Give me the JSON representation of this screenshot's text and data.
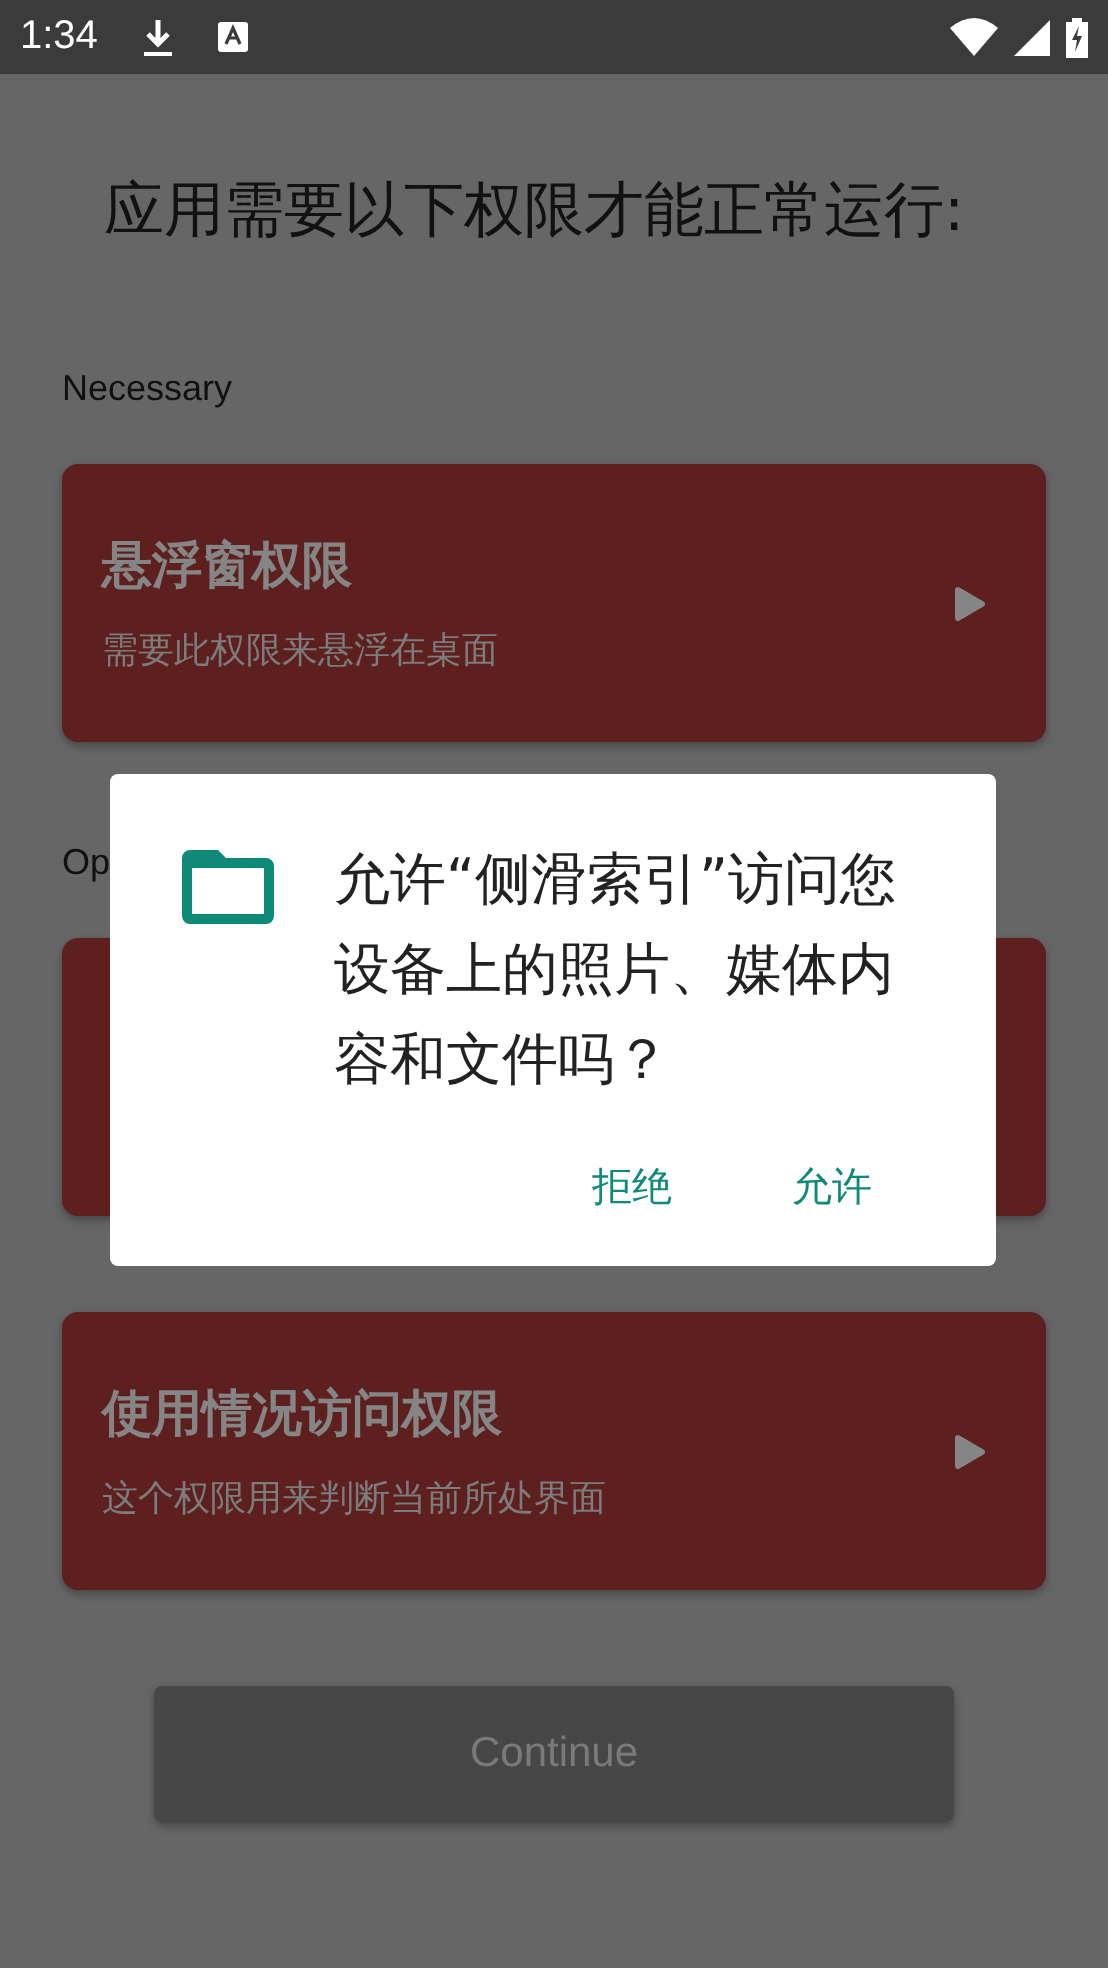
{
  "status_bar": {
    "time": "1:34"
  },
  "heading": "应用需要以下权限才能正常运行:",
  "sections": [
    {
      "label": "Necessary",
      "cards": [
        {
          "kind": "permission",
          "title": "悬浮窗权限",
          "description": "需要此权限来悬浮在桌面"
        }
      ]
    },
    {
      "label": "Op",
      "cards": [
        {
          "kind": "covered"
        },
        {
          "kind": "permission",
          "title": "使用情况访问权限",
          "description": "这个权限用来判断当前所处界面"
        }
      ]
    }
  ],
  "continue_button": {
    "label": "Continue",
    "disabled": true
  },
  "dialog": {
    "message": "允许“侧滑索引”访问您设备上的照片、媒体内容和文件吗？",
    "buttons": [
      "拒绝",
      "允许"
    ]
  }
}
